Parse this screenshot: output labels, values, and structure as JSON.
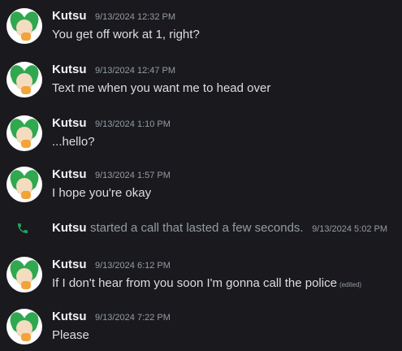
{
  "user": {
    "name": "Kutsu"
  },
  "messages": [
    {
      "time": "9/13/2024 12:32 PM",
      "text": "You get off work at 1, right?"
    },
    {
      "time": "9/13/2024 12:47 PM",
      "text": "Text me when you want me to head over"
    },
    {
      "time": "9/13/2024 1:10 PM",
      "text": "...hello?"
    },
    {
      "time": "9/13/2024 1:57 PM",
      "text": "I hope you're okay"
    },
    {
      "time": "9/13/2024 6:12 PM",
      "text": "If I don't hear from you soon I'm gonna call the police",
      "edited": "(edited)"
    },
    {
      "time": "9/13/2024 7:22 PM",
      "text": "Please"
    }
  ],
  "call_event": {
    "name": "Kutsu",
    "text": "started a call that lasted a few seconds.",
    "time": "9/13/2024 5:02 PM",
    "icon": "phone-icon",
    "icon_color": "#23a55a"
  }
}
